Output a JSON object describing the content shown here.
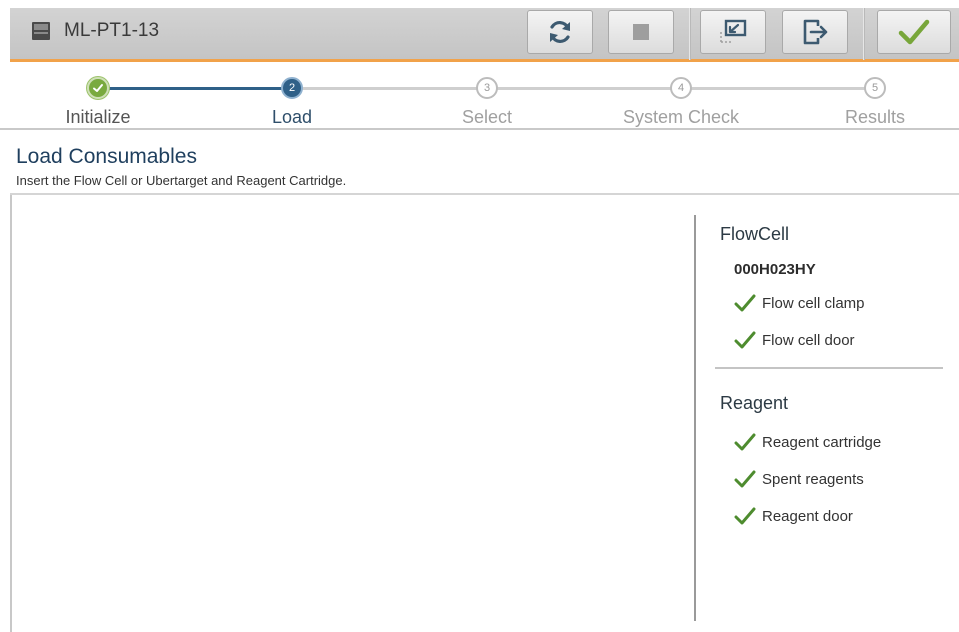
{
  "topbar": {
    "instrument_name": "ML-PT1-13",
    "buttons": [
      {
        "name": "refresh-button",
        "icon": "refresh-icon"
      },
      {
        "name": "stop-button",
        "icon": "stop-icon"
      },
      {
        "name": "minimize-button",
        "icon": "minimize-window-icon"
      },
      {
        "name": "exit-button",
        "icon": "exit-icon"
      },
      {
        "name": "confirm-button",
        "icon": "checkmark-icon"
      }
    ]
  },
  "stepper": {
    "steps": [
      {
        "number": "1",
        "label": "Initialize",
        "state": "done"
      },
      {
        "number": "2",
        "label": "Load",
        "state": "active"
      },
      {
        "number": "3",
        "label": "Select",
        "state": "todo"
      },
      {
        "number": "4",
        "label": "System Check",
        "state": "todo"
      },
      {
        "number": "5",
        "label": "Results",
        "state": "todo"
      }
    ]
  },
  "header": {
    "title": "Load Consumables",
    "subtitle": "Insert the Flow Cell or Ubertarget and Reagent Cartridge."
  },
  "status_panel": {
    "flowcell": {
      "title": "FlowCell",
      "serial": "000H023HY",
      "checks": [
        "Flow cell clamp",
        "Flow cell door"
      ]
    },
    "reagent": {
      "title": "Reagent",
      "checks": [
        "Reagent cartridge",
        "Spent reagents",
        "Reagent door"
      ]
    }
  },
  "colors": {
    "accent_orange": "#f1a24a",
    "step_done": "#79aa3e",
    "step_active": "#2f6088",
    "check_green": "#4e8c2f",
    "title_blue": "#1f3f5e"
  }
}
